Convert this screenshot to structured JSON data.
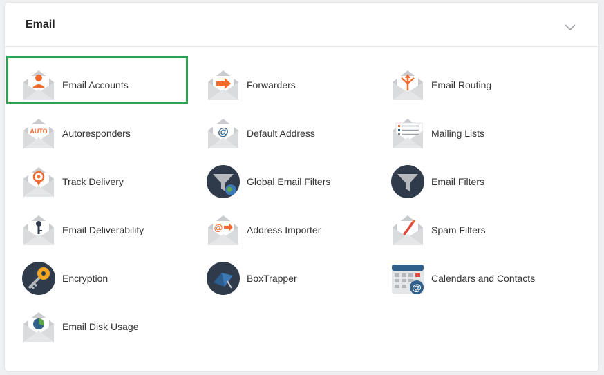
{
  "section": {
    "title": "Email"
  },
  "items": [
    {
      "label": "Email Accounts",
      "icon": "email-accounts-icon"
    },
    {
      "label": "Forwarders",
      "icon": "forwarders-icon"
    },
    {
      "label": "Email Routing",
      "icon": "email-routing-icon"
    },
    {
      "label": "Autoresponders",
      "icon": "autoresponders-icon",
      "badge": "AUTO"
    },
    {
      "label": "Default Address",
      "icon": "default-address-icon",
      "badge": "@"
    },
    {
      "label": "Mailing Lists",
      "icon": "mailing-lists-icon"
    },
    {
      "label": "Track Delivery",
      "icon": "track-delivery-icon"
    },
    {
      "label": "Global Email Filters",
      "icon": "global-email-filters-icon"
    },
    {
      "label": "Email Filters",
      "icon": "email-filters-icon"
    },
    {
      "label": "Email Deliverability",
      "icon": "email-deliverability-icon"
    },
    {
      "label": "Address Importer",
      "icon": "address-importer-icon",
      "badge": "@"
    },
    {
      "label": "Spam Filters",
      "icon": "spam-filters-icon"
    },
    {
      "label": "Encryption",
      "icon": "encryption-icon"
    },
    {
      "label": "BoxTrapper",
      "icon": "boxtrapper-icon"
    },
    {
      "label": "Calendars and Contacts",
      "icon": "calendars-contacts-icon",
      "badge": "@"
    },
    {
      "label": "Email Disk Usage",
      "icon": "email-disk-usage-icon"
    }
  ],
  "selected_item": "Email Accounts",
  "colors": {
    "accent_orange": "#f26a2e",
    "envelope_gray": "#c9cbce",
    "dark_circle": "#2f3a4a",
    "highlight_green": "#2aa44f"
  }
}
